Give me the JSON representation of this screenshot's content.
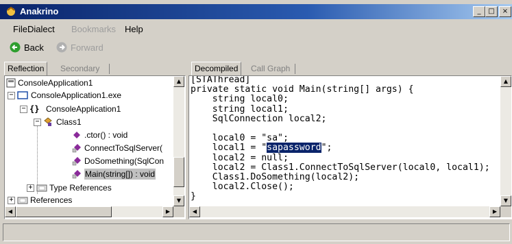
{
  "window": {
    "title": "Anakrino",
    "controls": {
      "minimize": "_",
      "maximize": "□",
      "close": "×"
    }
  },
  "menu": {
    "items": [
      {
        "label": "File",
        "enabled": true
      },
      {
        "label": "Dialect",
        "enabled": true
      },
      {
        "label": "Bookmarks",
        "enabled": false
      },
      {
        "label": "Help",
        "enabled": true
      }
    ]
  },
  "toolbar": {
    "back_label": "Back",
    "forward_label": "Forward",
    "back_color": "#2e9e2e",
    "forward_color": "#b0b0b0"
  },
  "left_panel": {
    "tabs": [
      {
        "label": "Reflection",
        "active": true
      },
      {
        "label": "Secondary",
        "active": false
      }
    ],
    "tree": [
      {
        "label": "ConsoleApplication1",
        "icon": "assembly-icon",
        "expander": ""
      },
      {
        "label": "ConsoleApplication1.exe",
        "icon": "module-icon",
        "expander": "−"
      },
      {
        "label": "ConsoleApplication1",
        "icon": "namespace-icon",
        "expander": "−"
      },
      {
        "label": "Class1",
        "icon": "class-icon",
        "expander": "−"
      },
      {
        "label": ".ctor() : void",
        "icon": "method-icon",
        "expander": ""
      },
      {
        "label": "ConnectToSqlServer(",
        "icon": "private-method-icon",
        "expander": ""
      },
      {
        "label": "DoSomething(SqlCon",
        "icon": "private-method-icon",
        "expander": ""
      },
      {
        "label": "Main(string[]) : void",
        "icon": "private-method-icon",
        "expander": "",
        "selected": true
      },
      {
        "label": "Type References",
        "icon": "folder-icon",
        "expander": "+"
      },
      {
        "label": "References",
        "icon": "folder-icon",
        "expander": "+"
      }
    ]
  },
  "right_panel": {
    "tabs": [
      {
        "label": "Decompiled",
        "active": true
      },
      {
        "label": "Call Graph",
        "active": false
      }
    ],
    "code": {
      "before": "[STAThread]\nprivate static void Main(string[] args) {\n    string local0;\n    string local1;\n    SqlConnection local2;\n\n    local0 = \"sa\";\n    local1 = \"",
      "highlight": "sapassword",
      "after": "\";\n    local2 = null;\n    local2 = Class1.ConnectToSqlServer(local0, local1);\n    Class1.DoSomething(local2);\n    local2.Close();\n}"
    }
  },
  "colors": {
    "titlebar_start": "#0a246a",
    "titlebar_end": "#a6caf0",
    "chrome": "#d4d0c8",
    "selection": "#0a246a"
  }
}
